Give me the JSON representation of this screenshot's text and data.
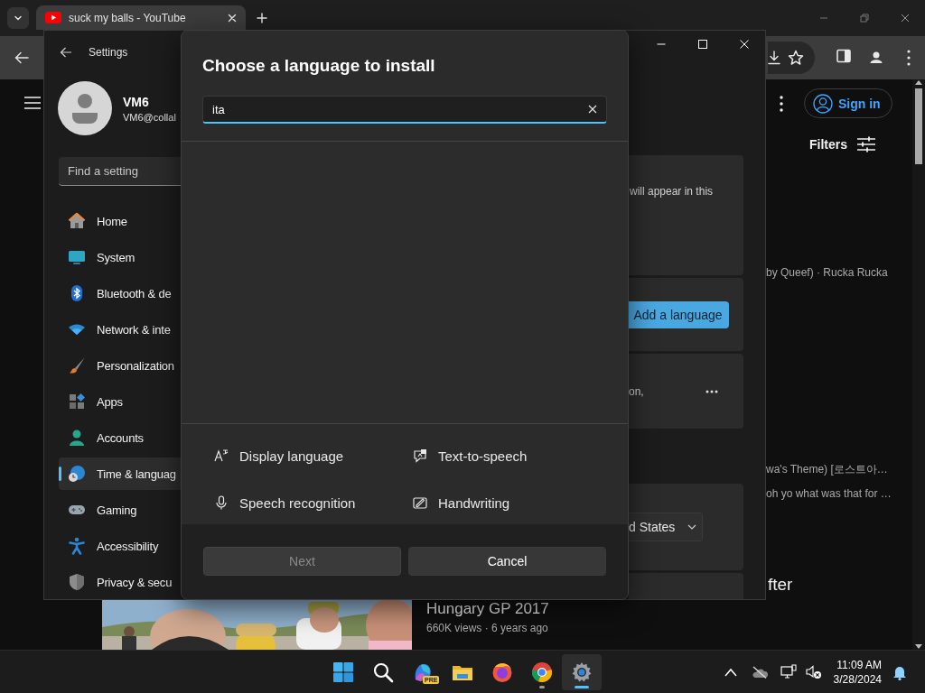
{
  "browser": {
    "tabs": [
      {
        "title": "suck my balls - YouTube",
        "selected": true
      }
    ],
    "youtube": {
      "sign_in": "Sign in",
      "filters": "Filters",
      "snippets": [
        "by Queef) · Rucka Rucka",
        "wa's Theme) [로스트아…",
        "oh yo what was that for …"
      ],
      "heading": "fter",
      "video": {
        "title": "Hungary GP 2017",
        "meta": "660K views · 6 years ago"
      }
    }
  },
  "settings": {
    "title": "Settings",
    "user": {
      "name": "VM6",
      "email": "VM6@collal"
    },
    "search": {
      "placeholder": "Find a setting"
    },
    "nav": [
      {
        "label": "Home",
        "selected": false
      },
      {
        "label": "System",
        "selected": false
      },
      {
        "label": "Bluetooth & de",
        "selected": false
      },
      {
        "label": "Network & inte",
        "selected": false
      },
      {
        "label": "Personalization",
        "selected": false
      },
      {
        "label": "Apps",
        "selected": false
      },
      {
        "label": "Accounts",
        "selected": false
      },
      {
        "label": "Time & languag",
        "selected": true
      },
      {
        "label": "Gaming",
        "selected": false
      },
      {
        "label": "Accessibility",
        "selected": false
      },
      {
        "label": "Privacy & secu",
        "selected": false
      }
    ],
    "cards": [
      {
        "kind": "text",
        "text": "will appear in this"
      },
      {
        "kind": "button",
        "label": "Add a language"
      },
      {
        "kind": "more",
        "text": "on,"
      },
      {
        "kind": "dropdown",
        "value": "d States"
      },
      {
        "kind": "empty"
      }
    ]
  },
  "dialog": {
    "title": "Choose a language to install",
    "search": {
      "value": "ita",
      "focused": true
    },
    "features": [
      {
        "label": "Display language"
      },
      {
        "label": "Text-to-speech"
      },
      {
        "label": "Speech recognition"
      },
      {
        "label": "Handwriting"
      }
    ],
    "buttons": [
      {
        "label": "Next",
        "disabled": true
      },
      {
        "label": "Cancel",
        "disabled": false
      }
    ]
  },
  "taskbar": {
    "apps": [
      {
        "selected": false,
        "running": false
      },
      {
        "selected": false,
        "running": false
      },
      {
        "badge": "PRE",
        "selected": false,
        "running": false
      },
      {
        "selected": false,
        "running": false
      },
      {
        "selected": false,
        "running": false
      },
      {
        "selected": false,
        "running": true
      },
      {
        "selected": true,
        "running": true
      }
    ],
    "time": "11:09 AM",
    "date": "3/28/2024"
  }
}
